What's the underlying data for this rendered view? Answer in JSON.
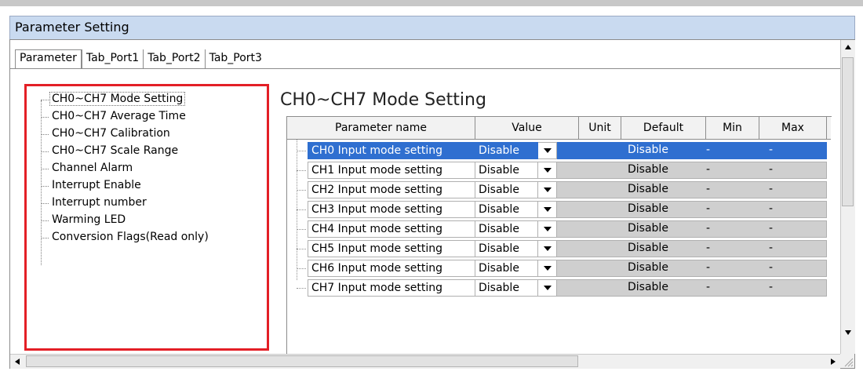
{
  "window": {
    "title": "Parameter Setting"
  },
  "tabs": [
    {
      "label": "Parameter",
      "active": true
    },
    {
      "label": "Tab_Port1",
      "active": false
    },
    {
      "label": "Tab_Port2",
      "active": false
    },
    {
      "label": "Tab_Port3",
      "active": false
    }
  ],
  "tree": {
    "items": [
      {
        "label": "CH0~CH7 Mode Setting",
        "selected": true
      },
      {
        "label": "CH0~CH7 Average Time"
      },
      {
        "label": "CH0~CH7 Calibration"
      },
      {
        "label": "CH0~CH7 Scale Range"
      },
      {
        "label": "Channel Alarm"
      },
      {
        "label": "Interrupt Enable"
      },
      {
        "label": "Interrupt number"
      },
      {
        "label": "Warming LED"
      },
      {
        "label": "Conversion Flags(Read only)"
      }
    ],
    "highlight_color": "#e31f26"
  },
  "main": {
    "heading": "CH0~CH7 Mode Setting",
    "columns": [
      "Parameter name",
      "Value",
      "Unit",
      "Default",
      "Min",
      "Max"
    ],
    "rows": [
      {
        "name": "CH0 Input mode setting",
        "value": "Disable",
        "unit": "",
        "default": "Disable",
        "min": "-",
        "max": "-",
        "selected": true
      },
      {
        "name": "CH1 Input mode setting",
        "value": "Disable",
        "unit": "",
        "default": "Disable",
        "min": "-",
        "max": "-"
      },
      {
        "name": "CH2 Input mode setting",
        "value": "Disable",
        "unit": "",
        "default": "Disable",
        "min": "-",
        "max": "-"
      },
      {
        "name": "CH3 Input mode setting",
        "value": "Disable",
        "unit": "",
        "default": "Disable",
        "min": "-",
        "max": "-"
      },
      {
        "name": "CH4 Input mode setting",
        "value": "Disable",
        "unit": "",
        "default": "Disable",
        "min": "-",
        "max": "-"
      },
      {
        "name": "CH5 Input mode setting",
        "value": "Disable",
        "unit": "",
        "default": "Disable",
        "min": "-",
        "max": "-"
      },
      {
        "name": "CH6 Input mode setting",
        "value": "Disable",
        "unit": "",
        "default": "Disable",
        "min": "-",
        "max": "-"
      },
      {
        "name": "CH7 Input mode setting",
        "value": "Disable",
        "unit": "",
        "default": "Disable",
        "min": "-",
        "max": "-"
      }
    ],
    "selection_color": "#2f6fd0"
  },
  "icons": {
    "dropdown": "chevron-down-icon",
    "scroll_up": "arrow-up-icon",
    "scroll_down": "arrow-down-icon",
    "scroll_left": "arrow-left-icon",
    "scroll_right": "arrow-right-icon",
    "grip": "resize-grip-icon"
  }
}
